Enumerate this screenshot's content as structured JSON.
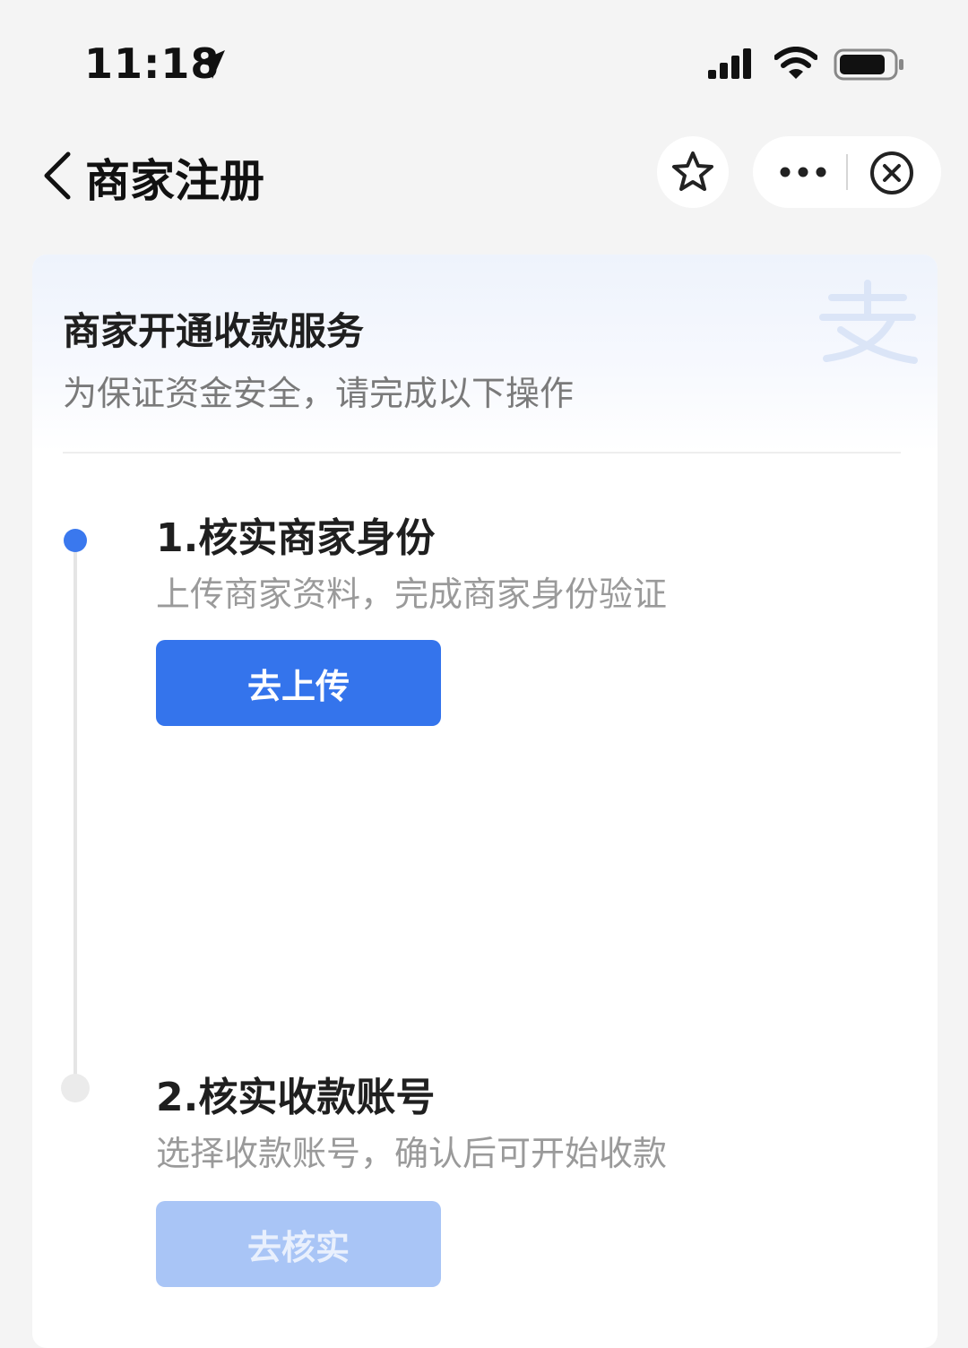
{
  "status_bar": {
    "time": "11:18",
    "icons": [
      "location-arrow-icon",
      "signal-icon",
      "wifi-icon",
      "battery-icon"
    ]
  },
  "nav": {
    "title": "商家注册",
    "icons": [
      "back-icon",
      "star-icon",
      "more-icon",
      "close-icon"
    ]
  },
  "card": {
    "title": "商家开通收款服务",
    "subtitle": "为保证资金安全，请完成以下操作",
    "watermark_icon": "alipay-logo-icon"
  },
  "steps": [
    {
      "title": "1.核实商家身份",
      "desc": "上传商家资料，完成商家身份验证",
      "button": "去上传",
      "state": "active"
    },
    {
      "title": "2.核实收款账号",
      "desc": "选择收款账号，确认后可开始收款",
      "button": "去核实",
      "state": "disabled"
    }
  ],
  "colors": {
    "primary": "#3474ec",
    "disabled": "#a9c5f6",
    "background": "#f4f4f4"
  }
}
